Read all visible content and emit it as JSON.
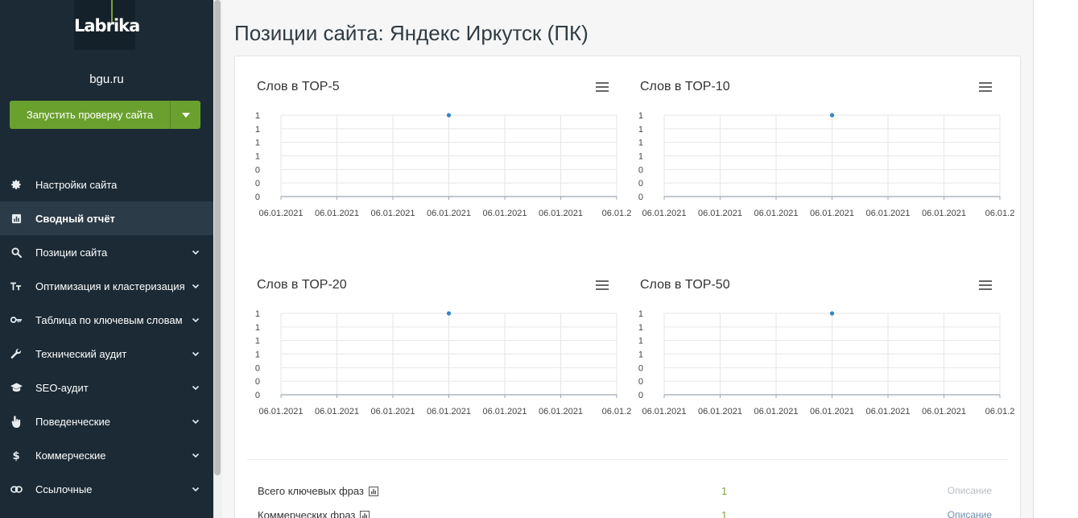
{
  "app": {
    "logo_text": "Labrika",
    "site_name": "bgu.ru",
    "run_button_label": "Запустить проверку сайта"
  },
  "sidebar": {
    "items": [
      {
        "label": "Настройки сайта",
        "icon": "gear-icon",
        "active": false,
        "has_chevron": false
      },
      {
        "label": "Сводный отчёт",
        "icon": "chart-icon",
        "active": true,
        "has_chevron": false
      },
      {
        "label": "Позиции сайта",
        "icon": "search-icon",
        "active": false,
        "has_chevron": true
      },
      {
        "label": "Оптимизация и кластеризация",
        "icon": "text-size-icon",
        "active": false,
        "has_chevron": true
      },
      {
        "label": "Таблица по ключевым словам",
        "icon": "key-icon",
        "active": false,
        "has_chevron": true
      },
      {
        "label": "Технический аудит",
        "icon": "wrench-icon",
        "active": false,
        "has_chevron": true
      },
      {
        "label": "SEO-аудит",
        "icon": "graduation-cap-icon",
        "active": false,
        "has_chevron": true
      },
      {
        "label": "Поведенческие",
        "icon": "hand-pointer-icon",
        "active": false,
        "has_chevron": true
      },
      {
        "label": "Коммерческие",
        "icon": "dollar-icon",
        "active": false,
        "has_chevron": true
      },
      {
        "label": "Ссылочные",
        "icon": "link-icon",
        "active": false,
        "has_chevron": true
      }
    ]
  },
  "main": {
    "title": "Позиции сайта: Яндекс Иркутск (ПК)"
  },
  "colors": {
    "sidebar_bg": "#1b2a35",
    "accent_green": "#6aa12e",
    "point_blue": "#2f86c8"
  },
  "chart_data": [
    {
      "type": "line",
      "title": "Слов в TOP-5",
      "x": [
        "06.01.2021",
        "06.01.2021",
        "06.01.2021",
        "06.01.2021",
        "06.01.2021",
        "06.01.2021",
        "06.01.2"
      ],
      "y_tick_labels": [
        "1",
        "1",
        "1",
        "1",
        "0",
        "0",
        "0"
      ],
      "series": [
        {
          "values": [
            null,
            null,
            null,
            1,
            null,
            null,
            null
          ]
        }
      ],
      "ylim": [
        0,
        1
      ],
      "grid": true
    },
    {
      "type": "line",
      "title": "Слов в TOP-10",
      "x": [
        "06.01.2021",
        "06.01.2021",
        "06.01.2021",
        "06.01.2021",
        "06.01.2021",
        "06.01.2021",
        "06.01.2"
      ],
      "y_tick_labels": [
        "1",
        "1",
        "1",
        "1",
        "0",
        "0",
        "0"
      ],
      "series": [
        {
          "values": [
            null,
            null,
            null,
            1,
            null,
            null,
            null
          ]
        }
      ],
      "ylim": [
        0,
        1
      ],
      "grid": true
    },
    {
      "type": "line",
      "title": "Слов в TOP-20",
      "x": [
        "06.01.2021",
        "06.01.2021",
        "06.01.2021",
        "06.01.2021",
        "06.01.2021",
        "06.01.2021",
        "06.01.2"
      ],
      "y_tick_labels": [
        "1",
        "1",
        "1",
        "1",
        "0",
        "0",
        "0"
      ],
      "series": [
        {
          "values": [
            null,
            null,
            null,
            1,
            null,
            null,
            null
          ]
        }
      ],
      "ylim": [
        0,
        1
      ],
      "grid": true
    },
    {
      "type": "line",
      "title": "Слов в TOP-50",
      "x": [
        "06.01.2021",
        "06.01.2021",
        "06.01.2021",
        "06.01.2021",
        "06.01.2021",
        "06.01.2021",
        "06.01.2"
      ],
      "y_tick_labels": [
        "1",
        "1",
        "1",
        "1",
        "0",
        "0",
        "0"
      ],
      "series": [
        {
          "values": [
            null,
            null,
            null,
            1,
            null,
            null,
            null
          ]
        }
      ],
      "ylim": [
        0,
        1
      ],
      "grid": true
    }
  ],
  "stats": [
    {
      "label": "Всего ключевых фраз",
      "value": "1",
      "link": "Описание"
    },
    {
      "label": "Коммерческих фраз",
      "value": "1",
      "link": "Описание"
    }
  ]
}
